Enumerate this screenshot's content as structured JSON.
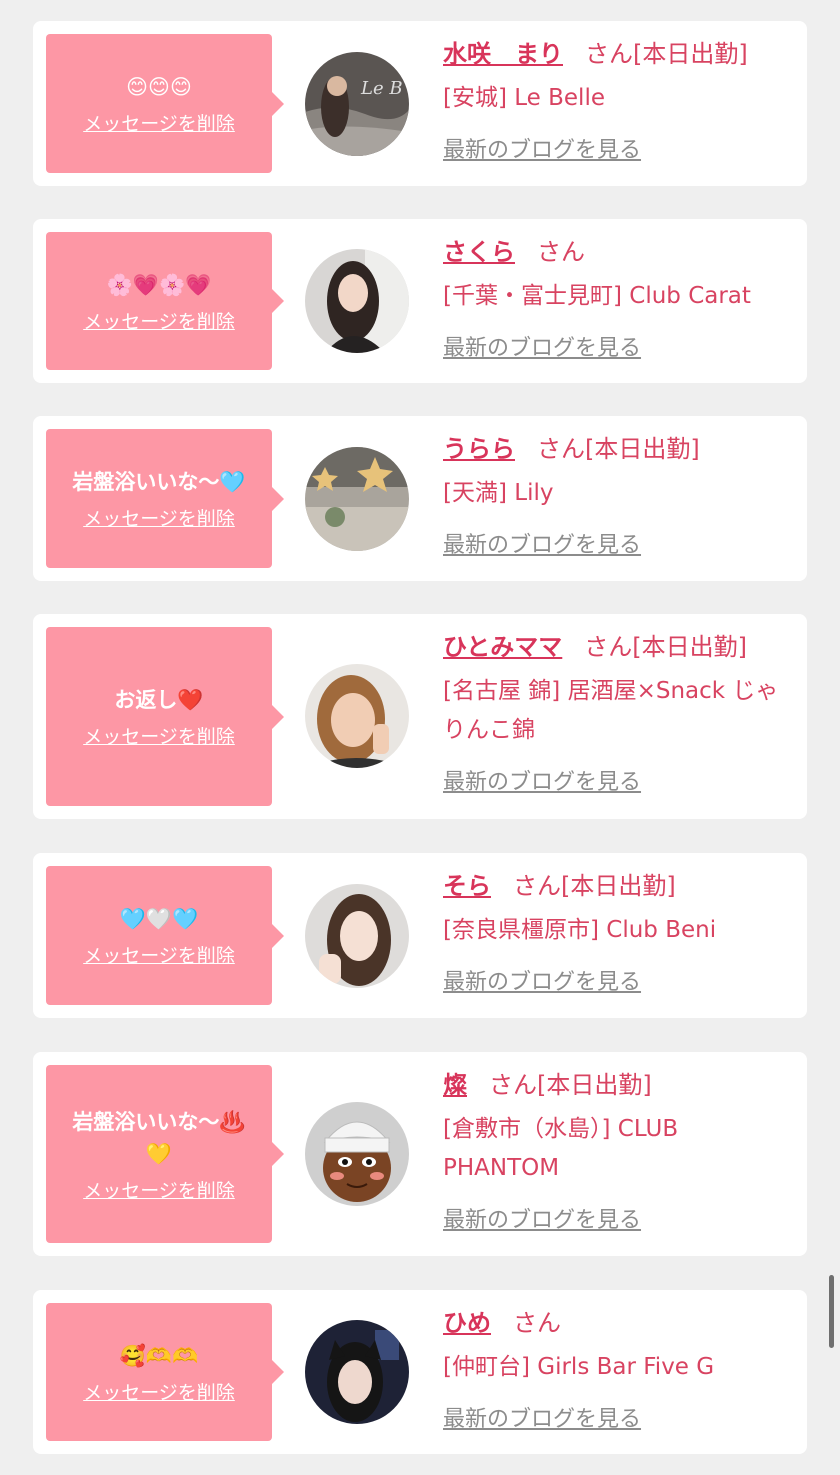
{
  "cards": [
    {
      "message": "😊😊😊",
      "delete_label": "メッセージを削除",
      "name": "水咲　まり",
      "san": "さん",
      "status": "[本日出勤]",
      "shop": "[安城] Le Belle",
      "blog_label": "最新のブログを見る"
    },
    {
      "message": "🌸💗🌸💗",
      "delete_label": "メッセージを削除",
      "name": "さくら",
      "san": "さん",
      "status": "",
      "shop": "[千葉・富士見町] Club Carat",
      "blog_label": "最新のブログを見る"
    },
    {
      "message": "岩盤浴いいな〜🩵",
      "delete_label": "メッセージを削除",
      "name": "うらら",
      "san": "さん",
      "status": "[本日出勤]",
      "shop": "[天満] Lily",
      "blog_label": "最新のブログを見る"
    },
    {
      "message": "お返し❤️",
      "delete_label": "メッセージを削除",
      "name": "ひとみママ",
      "san": "さん",
      "status": "[本日出勤]",
      "shop": "[名古屋 錦] 居酒屋×Snack じゃりんこ錦",
      "blog_label": "最新のブログを見る"
    },
    {
      "message": "🩵🤍🩵",
      "delete_label": "メッセージを削除",
      "name": "そら",
      "san": "さん",
      "status": "[本日出勤]",
      "shop": "[奈良県橿原市] Club Beni",
      "blog_label": "最新のブログを見る"
    },
    {
      "message": "岩盤浴いいな〜♨️\n💛",
      "delete_label": "メッセージを削除",
      "name": "燦",
      "san": "さん",
      "status": "[本日出勤]",
      "shop": "[倉敷市（水島）] CLUB PHANTOM",
      "blog_label": "最新のブログを見る"
    },
    {
      "message": "🥰🫶🫶",
      "delete_label": "メッセージを削除",
      "name": "ひめ",
      "san": "さん",
      "status": "",
      "shop": "[仲町台] Girls Bar Five G",
      "blog_label": "最新のブログを見る"
    }
  ]
}
